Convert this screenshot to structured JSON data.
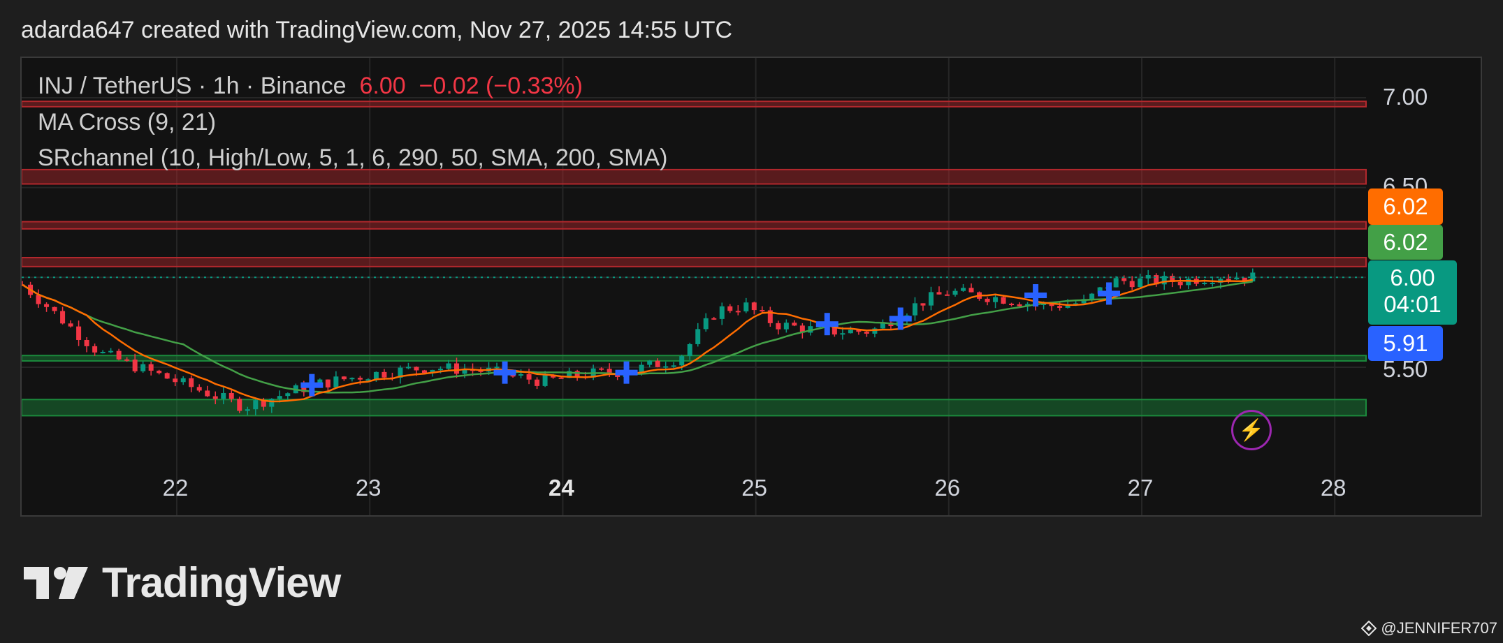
{
  "credit": "adarda647 created with TradingView.com, Nov 27, 2025 14:55 UTC",
  "legend": {
    "symbol": "INJ / TetherUS · 1h · Binance",
    "last": "6.00",
    "change": "−0.02 (−0.33%)",
    "indicator1": "MA Cross (9, 21)",
    "indicator2": "SRchannel (10, High/Low, 5, 1, 6, 290, 50, SMA, 200, SMA)"
  },
  "price_axis": {
    "labels": [
      "7.00",
      "6.50",
      "5.50"
    ]
  },
  "price_tags": {
    "ma_fast": "6.02",
    "ma_slow": "6.02",
    "last_price": "6.00",
    "countdown": "04:01",
    "cross": "5.91"
  },
  "time_axis": {
    "labels": [
      "22",
      "23",
      "24",
      "25",
      "26",
      "27",
      "28"
    ],
    "bold_label": "24"
  },
  "brand": {
    "logo_text": "TradingView",
    "watermark": "@JENNIFER707"
  },
  "icons": {
    "alert": "lightning-bolt-icon",
    "logo": "tradingview-logo-icon",
    "watermark": "binance-diamond-icon"
  },
  "colors": {
    "up": "#089981",
    "down": "#f23645",
    "ma_fast": "#ff6d00",
    "ma_slow": "#43a047",
    "resistance": "#b2282d",
    "support": "#1b8a3c",
    "cross": "#2962ff"
  },
  "chart_data": {
    "type": "candlestick",
    "interval": "1h",
    "x_labels": [
      "22",
      "23",
      "24",
      "25",
      "26",
      "27",
      "28"
    ],
    "ylim": [
      5.15,
      7.15
    ],
    "series": [
      {
        "name": "INJ / TetherUS",
        "kind": "candles",
        "anchors": [
          [
            21.2,
            5.96
          ],
          [
            21.6,
            5.58
          ],
          [
            22.0,
            5.42
          ],
          [
            22.35,
            5.28
          ],
          [
            22.7,
            5.4
          ],
          [
            23.0,
            5.46
          ],
          [
            23.3,
            5.5
          ],
          [
            23.6,
            5.48
          ],
          [
            23.9,
            5.42
          ],
          [
            24.1,
            5.46
          ],
          [
            24.35,
            5.48
          ],
          [
            24.6,
            5.55
          ],
          [
            24.8,
            5.82
          ],
          [
            24.95,
            5.84
          ],
          [
            25.1,
            5.74
          ],
          [
            25.35,
            5.7
          ],
          [
            25.6,
            5.7
          ],
          [
            25.85,
            5.86
          ],
          [
            26.0,
            5.92
          ],
          [
            26.3,
            5.88
          ],
          [
            26.5,
            5.84
          ],
          [
            26.7,
            5.86
          ],
          [
            26.85,
            5.98
          ],
          [
            27.0,
            5.98
          ],
          [
            27.2,
            5.98
          ],
          [
            27.4,
            6.01
          ],
          [
            27.59,
            6.0
          ]
        ]
      },
      {
        "name": "MA Cross fast (9)",
        "kind": "line"
      },
      {
        "name": "MA Cross slow (21)",
        "kind": "line"
      }
    ],
    "sr_zones": [
      {
        "kind": "resistance",
        "range": [
          6.95,
          6.98
        ]
      },
      {
        "kind": "resistance",
        "range": [
          6.52,
          6.6
        ]
      },
      {
        "kind": "resistance",
        "range": [
          6.27,
          6.31
        ]
      },
      {
        "kind": "resistance",
        "range": [
          6.06,
          6.11
        ]
      },
      {
        "kind": "support",
        "range": [
          5.535,
          5.565
        ]
      },
      {
        "kind": "support",
        "range": [
          5.23,
          5.32
        ]
      }
    ],
    "cross_markers": [
      [
        22.7,
        5.4
      ],
      [
        23.7,
        5.47
      ],
      [
        24.33,
        5.47
      ],
      [
        25.37,
        5.74
      ],
      [
        25.75,
        5.77
      ],
      [
        26.45,
        5.9
      ],
      [
        26.83,
        5.91
      ]
    ]
  }
}
